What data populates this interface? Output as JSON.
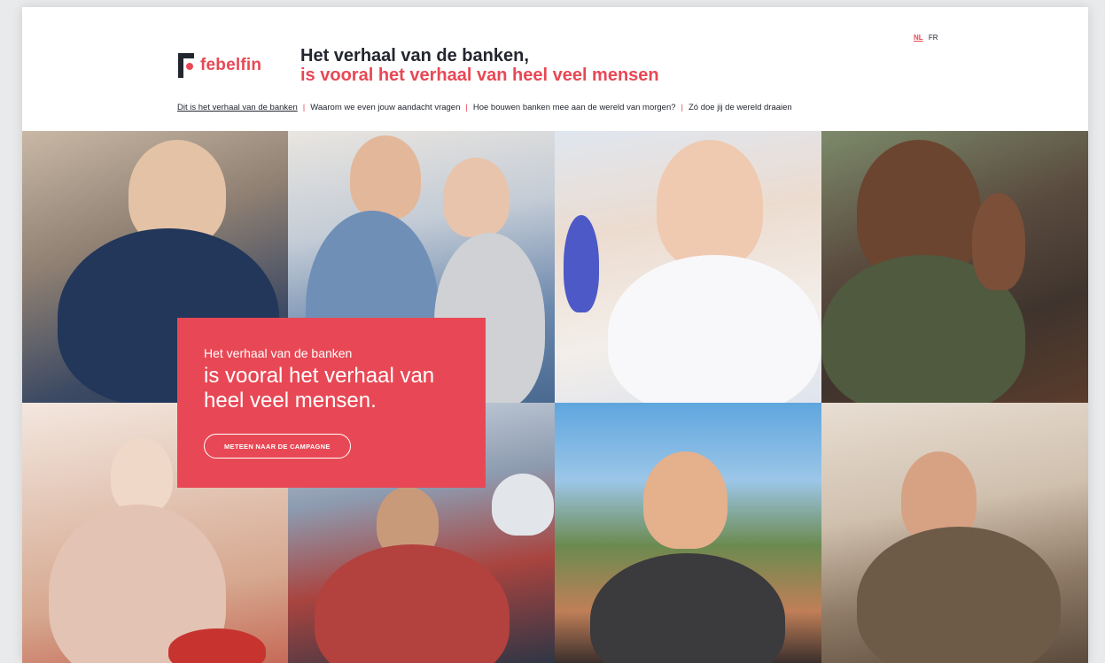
{
  "brand": {
    "logo_text": "febelfin"
  },
  "headline": {
    "line1": "Het verhaal van de banken,",
    "line2": "is vooral het verhaal van heel veel mensen"
  },
  "languages": {
    "nl": "NL",
    "fr": "FR",
    "active": "NL"
  },
  "nav": {
    "items": [
      "Dit is het verhaal van de banken",
      "Waarom we even jouw aandacht vragen",
      "Hoe bouwen banken mee aan de wereld van morgen?",
      "Zó doe jij de wereld draaien"
    ],
    "active_index": 0
  },
  "card": {
    "small": "Het verhaal van de banken",
    "big": "is vooral het verhaal van heel veel mensen.",
    "cta": "METEEN NAAR DE CAMPAGNE"
  },
  "colors": {
    "accent": "#e84855",
    "text": "#23262f"
  }
}
